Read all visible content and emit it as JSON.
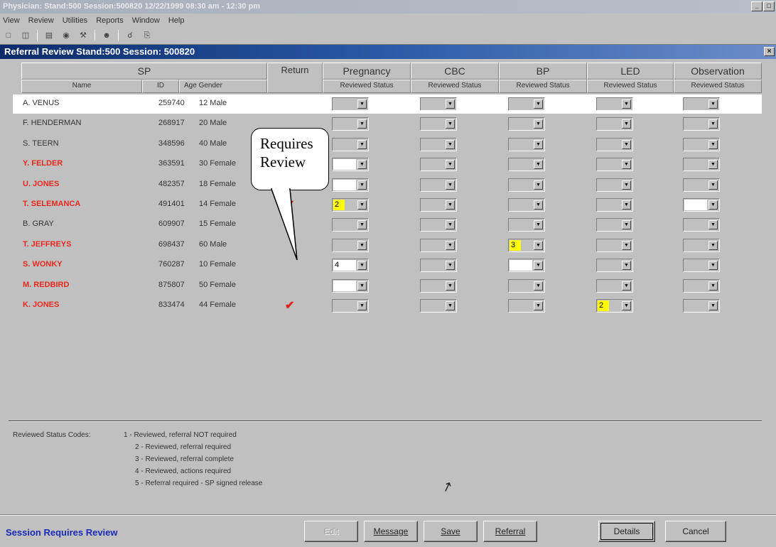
{
  "app": {
    "title": "Physician: Stand:500 Session:500820 12/22/1999 08:30 am - 12:30 pm",
    "window_buttons": [
      "_",
      "□"
    ]
  },
  "menu": [
    "View",
    "Review",
    "Utilities",
    "Reports",
    "Window",
    "Help"
  ],
  "toolbar_icons": [
    "new-icon",
    "open-icon",
    "print-icon",
    "preview-icon",
    "tools-icon",
    "users-icon",
    "help-icon",
    "exit-icon"
  ],
  "child_window": {
    "title": "Referral Review Stand:500 Session: 500820",
    "close": "×"
  },
  "headers": {
    "sp": "SP",
    "return": "Return",
    "groups": [
      "Pregnancy",
      "CBC",
      "BP",
      "LED",
      "Observation"
    ],
    "sub": {
      "name": "Name",
      "id": "ID",
      "age_gender": "Age Gender"
    },
    "reviewed_status": "Reviewed Status"
  },
  "rows": [
    {
      "name": "A. VENUS",
      "id": "259740",
      "age_gender": "12 Male",
      "red": false,
      "return": "",
      "status": [
        {
          "v": "",
          "s": "gray"
        },
        {
          "v": "",
          "s": "gray"
        },
        {
          "v": "",
          "s": "gray"
        },
        {
          "v": "",
          "s": "gray"
        },
        {
          "v": "",
          "s": "gray"
        }
      ]
    },
    {
      "name": "F. HENDERMAN",
      "id": "268917",
      "age_gender": "20 Male",
      "red": false,
      "return": "",
      "status": [
        {
          "v": "",
          "s": "gray"
        },
        {
          "v": "",
          "s": "gray"
        },
        {
          "v": "",
          "s": "gray"
        },
        {
          "v": "",
          "s": "gray"
        },
        {
          "v": "",
          "s": "gray"
        }
      ]
    },
    {
      "name": "S. TEERN",
      "id": "348596",
      "age_gender": "40 Male",
      "red": false,
      "return": "",
      "status": [
        {
          "v": "",
          "s": "gray"
        },
        {
          "v": "",
          "s": "gray"
        },
        {
          "v": "",
          "s": "gray"
        },
        {
          "v": "",
          "s": "gray"
        },
        {
          "v": "",
          "s": "gray"
        }
      ]
    },
    {
      "name": "Y. FELDER",
      "id": "363591",
      "age_gender": "30 Female",
      "red": true,
      "return": "",
      "status": [
        {
          "v": "",
          "s": "white"
        },
        {
          "v": "",
          "s": "gray"
        },
        {
          "v": "",
          "s": "gray"
        },
        {
          "v": "",
          "s": "gray"
        },
        {
          "v": "",
          "s": "gray"
        }
      ]
    },
    {
      "name": "U. JONES",
      "id": "482357",
      "age_gender": "18 Female",
      "red": true,
      "return": "",
      "status": [
        {
          "v": "",
          "s": "white"
        },
        {
          "v": "",
          "s": "gray"
        },
        {
          "v": "",
          "s": "gray"
        },
        {
          "v": "",
          "s": "gray"
        },
        {
          "v": "",
          "s": "gray"
        }
      ]
    },
    {
      "name": "T. SELEMANCA",
      "id": "491401",
      "age_gender": "14 Female",
      "red": true,
      "return": "✔",
      "status": [
        {
          "v": "2",
          "s": "yellow"
        },
        {
          "v": "",
          "s": "gray"
        },
        {
          "v": "",
          "s": "gray"
        },
        {
          "v": "",
          "s": "gray"
        },
        {
          "v": "",
          "s": "white"
        }
      ]
    },
    {
      "name": "B. GRAY",
      "id": "609907",
      "age_gender": "15 Female",
      "red": false,
      "return": "",
      "status": [
        {
          "v": "",
          "s": "gray"
        },
        {
          "v": "",
          "s": "gray"
        },
        {
          "v": "",
          "s": "gray"
        },
        {
          "v": "",
          "s": "gray"
        },
        {
          "v": "",
          "s": "gray"
        }
      ]
    },
    {
      "name": "T. JEFFREYS",
      "id": "698437",
      "age_gender": "60 Male",
      "red": true,
      "return": "",
      "status": [
        {
          "v": "",
          "s": "gray"
        },
        {
          "v": "",
          "s": "gray"
        },
        {
          "v": "3",
          "s": "yellow"
        },
        {
          "v": "",
          "s": "gray"
        },
        {
          "v": "",
          "s": "gray"
        }
      ]
    },
    {
      "name": "S. WONKY",
      "id": "760287",
      "age_gender": "10 Female",
      "red": true,
      "return": "",
      "status": [
        {
          "v": "4",
          "s": "white"
        },
        {
          "v": "",
          "s": "gray"
        },
        {
          "v": "",
          "s": "white"
        },
        {
          "v": "",
          "s": "gray"
        },
        {
          "v": "",
          "s": "gray"
        }
      ]
    },
    {
      "name": "M. REDBIRD",
      "id": "875807",
      "age_gender": "50 Female",
      "red": true,
      "return": "",
      "status": [
        {
          "v": "",
          "s": "white"
        },
        {
          "v": "",
          "s": "gray"
        },
        {
          "v": "",
          "s": "gray"
        },
        {
          "v": "",
          "s": "gray"
        },
        {
          "v": "",
          "s": "gray"
        }
      ]
    },
    {
      "name": "K. JONES",
      "id": "833474",
      "age_gender": "44 Female",
      "red": true,
      "return": "✔",
      "status": [
        {
          "v": "",
          "s": "gray"
        },
        {
          "v": "",
          "s": "gray"
        },
        {
          "v": "",
          "s": "gray"
        },
        {
          "v": "2",
          "s": "yellow"
        },
        {
          "v": "",
          "s": "gray"
        }
      ]
    }
  ],
  "callout": {
    "line1": "Requires",
    "line2": "Review"
  },
  "legend": {
    "label": "Reviewed Status Codes:",
    "codes": [
      "1 - Reviewed, referral NOT required",
      "2 - Reviewed, referral required",
      "3 - Reviewed, referral complete",
      "4 - Reviewed, actions required",
      "5 - Referral required - SP signed release"
    ]
  },
  "status_bar": {
    "text": "Session Requires Review"
  },
  "buttons": {
    "first": "Edit",
    "message": "Message",
    "save": "Save",
    "referral": "Referral",
    "details": "Details",
    "cancel": "Cancel"
  },
  "colors": {
    "red_name": "#e8281c",
    "highlight": "#ffff00",
    "title_bar": "#0a2a6a",
    "status_text": "#1a2ab8"
  }
}
